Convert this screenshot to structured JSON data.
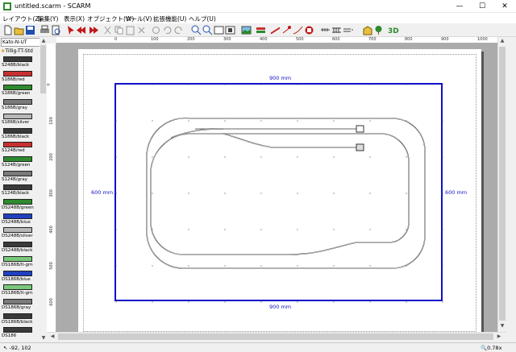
{
  "window": {
    "title": "untitled.scarm - SCARM",
    "minimize": "—",
    "maximize": "☐",
    "close": "✕"
  },
  "menu": [
    "レイアウト(Z)",
    "編集(Y)",
    "表示(X)",
    "オブジェクト(W)",
    "ツール(V)",
    "拡張機能(U)",
    "ヘルプ(U)"
  ],
  "sidebar": {
    "library": "Kato-N-UT",
    "group": "Tillig-TT-Std",
    "items": [
      {
        "label": "S248B/black",
        "color": "#3a3a3a"
      },
      {
        "label": "S186B/red",
        "color": "#c83030"
      },
      {
        "label": "S186B/green",
        "color": "#2e8a2e"
      },
      {
        "label": "S186B/gray",
        "color": "#7a7a7a"
      },
      {
        "label": "S186B/silver",
        "color": "#b8b8b8"
      },
      {
        "label": "S186B/black",
        "color": "#3a3a3a"
      },
      {
        "label": "S124B/red",
        "color": "#c83030"
      },
      {
        "label": "S124B/green",
        "color": "#2e8a2e"
      },
      {
        "label": "S124B/gray",
        "color": "#7a7a7a"
      },
      {
        "label": "S124B/black",
        "color": "#3a3a3a"
      },
      {
        "label": "DS248B/green",
        "color": "#2e8a2e"
      },
      {
        "label": "DS248B/blue",
        "color": "#2040c0"
      },
      {
        "label": "DS248B/silver",
        "color": "#b8b8b8"
      },
      {
        "label": "DS248B/black",
        "color": "#3a3a3a"
      },
      {
        "label": "DS186B/lt-grn",
        "color": "#7ac87a"
      },
      {
        "label": "DS186B/blue",
        "color": "#2040c0"
      },
      {
        "label": "DS186B/lt-grn",
        "color": "#7ac87a"
      },
      {
        "label": "DS186B/gray",
        "color": "#7a7a7a"
      },
      {
        "label": "DS186B/black",
        "color": "#3a3a3a"
      },
      {
        "label": "DS186",
        "color": "#3a3a3a"
      }
    ]
  },
  "ruler": {
    "top": [
      "0",
      "100",
      "200",
      "300",
      "400",
      "500",
      "600",
      "700",
      "800",
      "900",
      "1000"
    ],
    "left": [
      "0",
      "100",
      "200",
      "300",
      "400",
      "500",
      "600"
    ]
  },
  "layout": {
    "board_width_label": "900 mm",
    "board_height_label": "600 mm",
    "board_color": "#1010c8"
  },
  "status": {
    "coords": "-92, 102",
    "zoom": "0.78x"
  },
  "colors": {
    "accent": "#1010c8",
    "workspace": "#ababab",
    "track": "#333333"
  }
}
